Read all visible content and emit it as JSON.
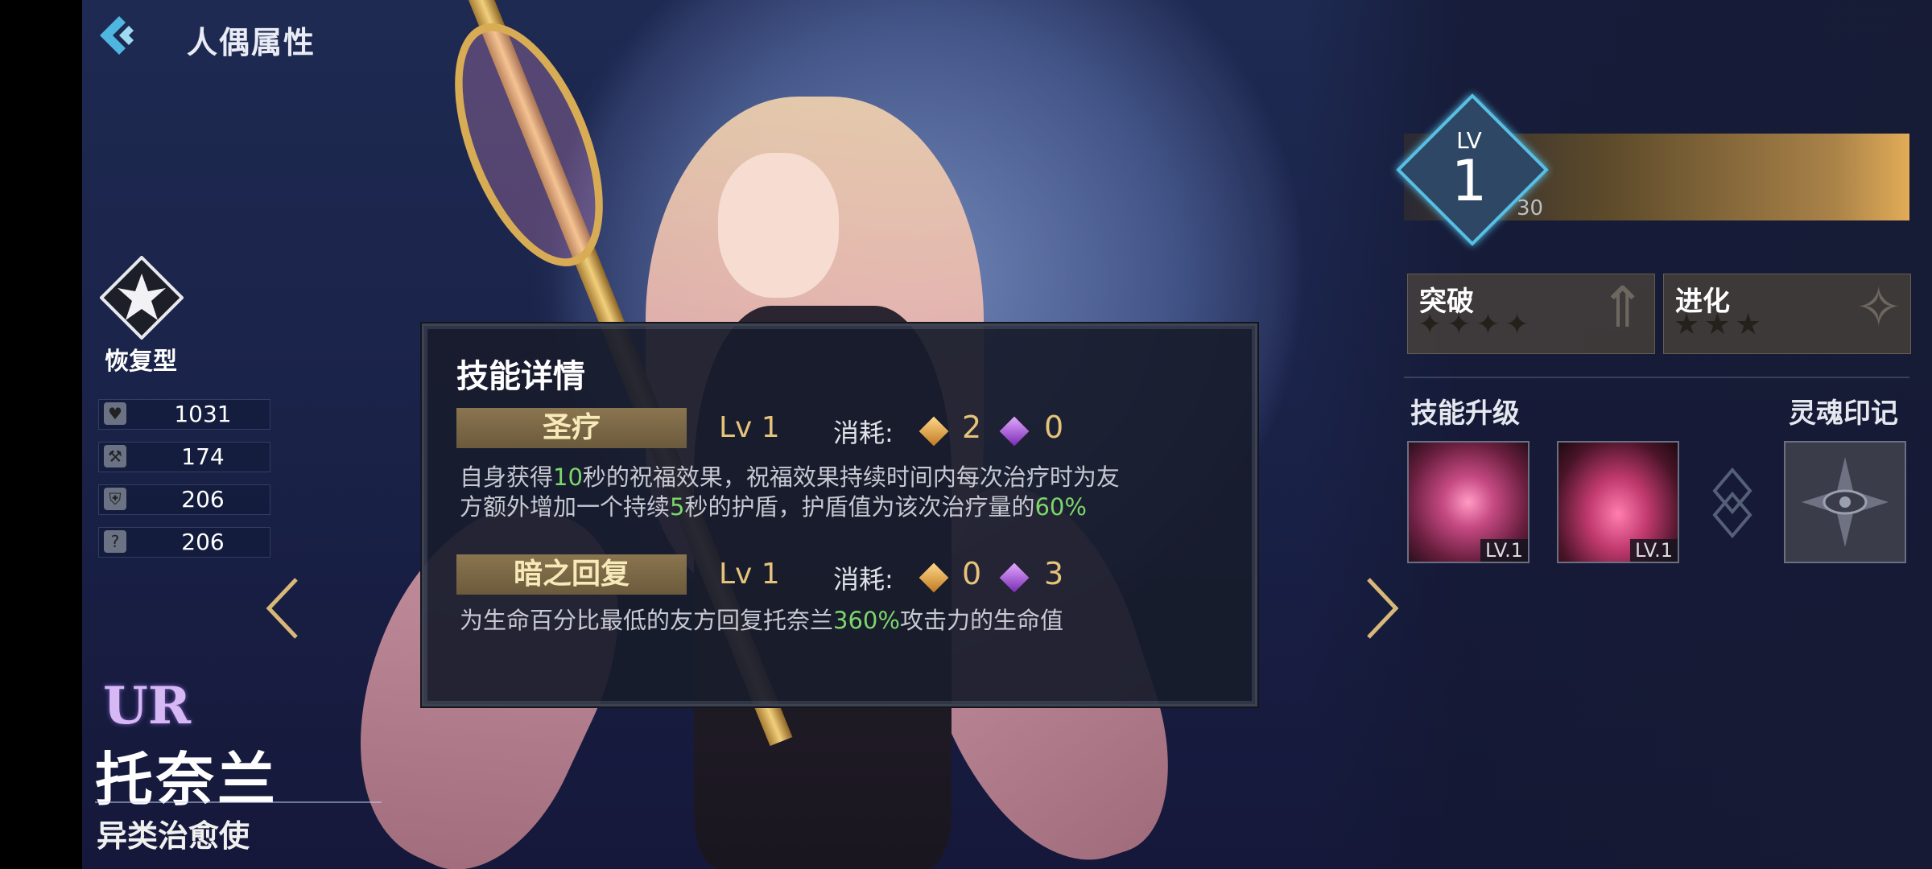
{
  "header": {
    "title": "人偶属性"
  },
  "character": {
    "type_label": "恢复型",
    "rarity": "UR",
    "name": "托奈兰",
    "title": "异类治愈使",
    "stats": [
      {
        "icon": "heart-icon",
        "value": "1031"
      },
      {
        "icon": "attack-icon",
        "value": "174"
      },
      {
        "icon": "defense-icon",
        "value": "206"
      },
      {
        "icon": "resist-icon",
        "value": "206"
      }
    ]
  },
  "level": {
    "label": "LV",
    "value": "1",
    "max": "30"
  },
  "breakthrough": {
    "label": "突破",
    "stars": "✦✦✦✦"
  },
  "evolution": {
    "label": "进化",
    "stars": "★★★"
  },
  "sections": {
    "skill_upgrade": "技能升级",
    "soul_mark": "灵魂印记"
  },
  "skill_slots": [
    {
      "level": "LV.1"
    },
    {
      "level": "LV.1"
    }
  ],
  "popup": {
    "title": "技能详情",
    "cost_label": "消耗:",
    "skills": [
      {
        "name": "圣疗",
        "level": "Lv 1",
        "cost_gold": "2",
        "cost_purple": "0",
        "desc": [
          {
            "t": "自身获得",
            "h": false
          },
          {
            "t": "10",
            "h": true
          },
          {
            "t": "秒的祝福效果，祝福效果持续时间内每次治疗时为友方额外增加一个持续",
            "h": false
          },
          {
            "t": "5",
            "h": true
          },
          {
            "t": "秒的护盾，护盾值为该次治疗量的",
            "h": false
          },
          {
            "t": "60%",
            "h": true
          }
        ]
      },
      {
        "name": "暗之回复",
        "level": "Lv 1",
        "cost_gold": "0",
        "cost_purple": "3",
        "desc": [
          {
            "t": "为生命百分比最低的友方回复托奈兰",
            "h": false
          },
          {
            "t": "360%",
            "h": true
          },
          {
            "t": "攻击力的生命值",
            "h": false
          }
        ]
      }
    ]
  },
  "colors": {
    "accent_cyan": "#58bfe4",
    "gold": "#e6c37a",
    "highlight_green": "#7cd66c"
  }
}
